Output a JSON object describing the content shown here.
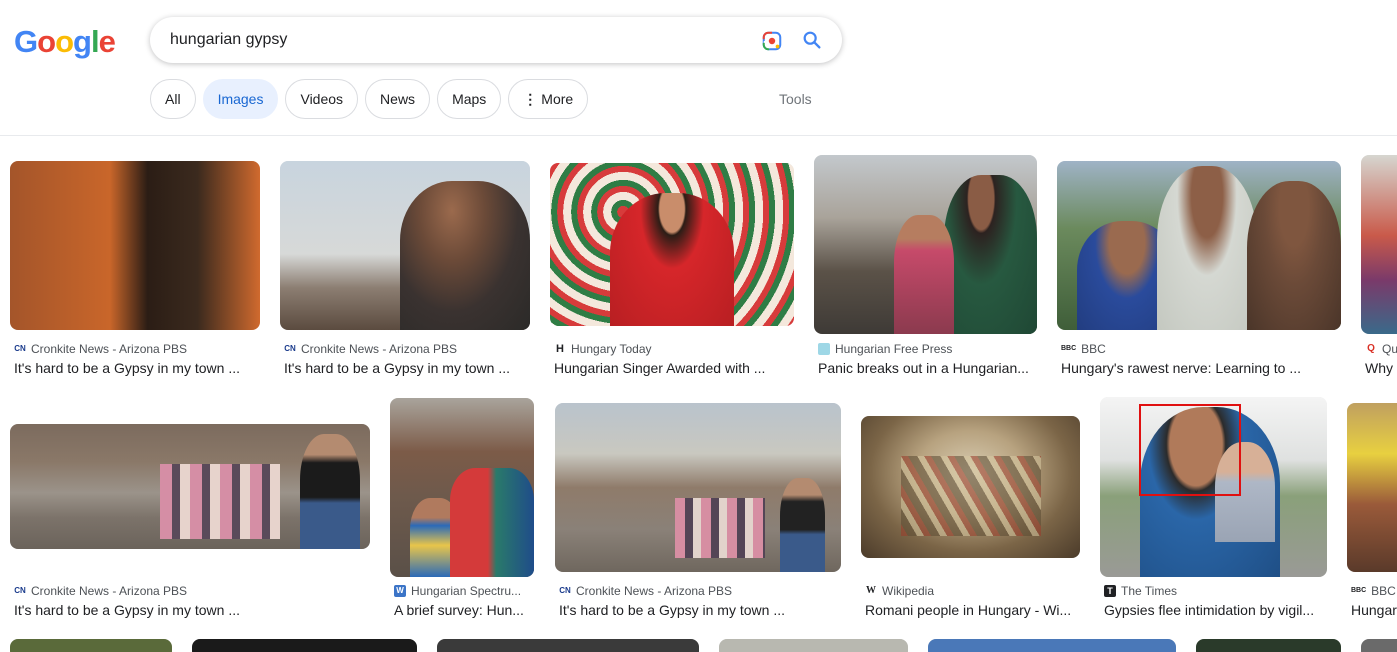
{
  "logo": [
    "G",
    "o",
    "o",
    "g",
    "l",
    "e"
  ],
  "search": {
    "query": "hungarian gypsy"
  },
  "tabs": {
    "all": "All",
    "images": "Images",
    "videos": "Videos",
    "news": "News",
    "maps": "Maps",
    "more": "More",
    "tools": "Tools"
  },
  "results": [
    {
      "source": "Cronkite News - Arizona PBS",
      "title": "It's hard to be a Gypsy in my town ...",
      "icon": "CN"
    },
    {
      "source": "Cronkite News - Arizona PBS",
      "title": "It's hard to be a Gypsy in my town ...",
      "icon": "CN"
    },
    {
      "source": "Hungary Today",
      "title": "Hungarian Singer Awarded with ...",
      "icon": "H"
    },
    {
      "source": "Hungarian Free Press",
      "title": "Panic breaks out in a Hungarian...",
      "icon": ""
    },
    {
      "source": "BBC",
      "title": "Hungary's rawest nerve: Learning to ...",
      "icon": "BBC"
    },
    {
      "source": "Qu",
      "title": "Why c",
      "icon": "Q"
    },
    {
      "source": "Cronkite News - Arizona PBS",
      "title": "It's hard to be a Gypsy in my town ...",
      "icon": "CN"
    },
    {
      "source": "Hungarian Spectru...",
      "title": "A brief survey: Hun...",
      "icon": "W"
    },
    {
      "source": "Cronkite News - Arizona PBS",
      "title": "It's hard to be a Gypsy in my town ...",
      "icon": "CN"
    },
    {
      "source": "Wikipedia",
      "title": "Romani people in Hungary - Wi...",
      "icon": "W"
    },
    {
      "source": "The Times",
      "title": "Gypsies flee intimidation by vigil...",
      "icon": "T"
    },
    {
      "source": "BBC",
      "title": "Hungar",
      "icon": "BBC"
    }
  ],
  "colors": {
    "blue": "#4285f4",
    "red": "#ea4335",
    "yellow": "#fbbc05",
    "green": "#34a853",
    "accent": "#1967d2"
  }
}
